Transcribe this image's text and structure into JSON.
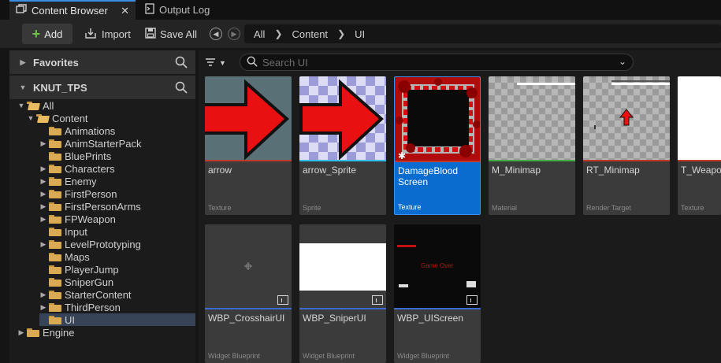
{
  "tabs": [
    {
      "label": "Content Browser",
      "icon": "content-browser-icon",
      "active": true
    },
    {
      "label": "Output Log",
      "icon": "output-log-icon",
      "active": false
    }
  ],
  "toolbar": {
    "add_label": "Add",
    "import_label": "Import",
    "save_all_label": "Save All"
  },
  "breadcrumb": [
    "All",
    "Content",
    "UI"
  ],
  "sidebar": {
    "favorites_label": "Favorites",
    "project_label": "KNUT_TPS",
    "tree": [
      {
        "label": "All",
        "depth": 0,
        "expanded": true
      },
      {
        "label": "Content",
        "depth": 1,
        "expanded": true
      },
      {
        "label": "Animations",
        "depth": 2,
        "has_children": false
      },
      {
        "label": "AnimStarterPack",
        "depth": 2,
        "has_children": true
      },
      {
        "label": "BluePrints",
        "depth": 2,
        "has_children": false
      },
      {
        "label": "Characters",
        "depth": 2,
        "has_children": true
      },
      {
        "label": "Enemy",
        "depth": 2,
        "has_children": true
      },
      {
        "label": "FirstPerson",
        "depth": 2,
        "has_children": true
      },
      {
        "label": "FirstPersonArms",
        "depth": 2,
        "has_children": true
      },
      {
        "label": "FPWeapon",
        "depth": 2,
        "has_children": true
      },
      {
        "label": "Input",
        "depth": 2,
        "has_children": false
      },
      {
        "label": "LevelPrototyping",
        "depth": 2,
        "has_children": true
      },
      {
        "label": "Maps",
        "depth": 2,
        "has_children": false
      },
      {
        "label": "PlayerJump",
        "depth": 2,
        "has_children": false
      },
      {
        "label": "SniperGun",
        "depth": 2,
        "has_children": false
      },
      {
        "label": "StarterContent",
        "depth": 2,
        "has_children": true
      },
      {
        "label": "ThirdPerson",
        "depth": 2,
        "has_children": true
      },
      {
        "label": "UI",
        "depth": 2,
        "has_children": false,
        "selected": true
      },
      {
        "label": "Engine",
        "depth": 0,
        "has_children": true
      }
    ]
  },
  "search": {
    "placeholder": "Search UI"
  },
  "assets": [
    {
      "name": "arrow",
      "type": "Texture",
      "stripe_color": "#c0392b"
    },
    {
      "name": "arrow_Sprite",
      "type": "Sprite",
      "stripe_color": "#33c0e6"
    },
    {
      "name": "DamageBlood Screen",
      "type": "Texture",
      "stripe_color": "#c0392b",
      "selected": true
    },
    {
      "name": "M_Minimap",
      "type": "Material",
      "stripe_color": "#3fae3f"
    },
    {
      "name": "RT_Minimap",
      "type": "Render Target",
      "stripe_color": "#c0392b"
    },
    {
      "name": "T_Weapon GrenadeG",
      "type": "Texture",
      "stripe_color": "#c0392b"
    },
    {
      "name": "WBP_CrosshairUI",
      "type": "Widget Blueprint",
      "stripe_color": "#3a6ad0"
    },
    {
      "name": "WBP_SniperUI",
      "type": "Widget Blueprint",
      "stripe_color": "#3a6ad0"
    },
    {
      "name": "WBP_UIScreen",
      "type": "Widget Blueprint",
      "stripe_color": "#3a6ad0",
      "thumb_text": "Game Over"
    }
  ],
  "colors": {
    "accent": "#0a6ccf",
    "add_plus": "#6cc24a",
    "folder": "#d9a954",
    "arrow_red": "#e81010"
  }
}
